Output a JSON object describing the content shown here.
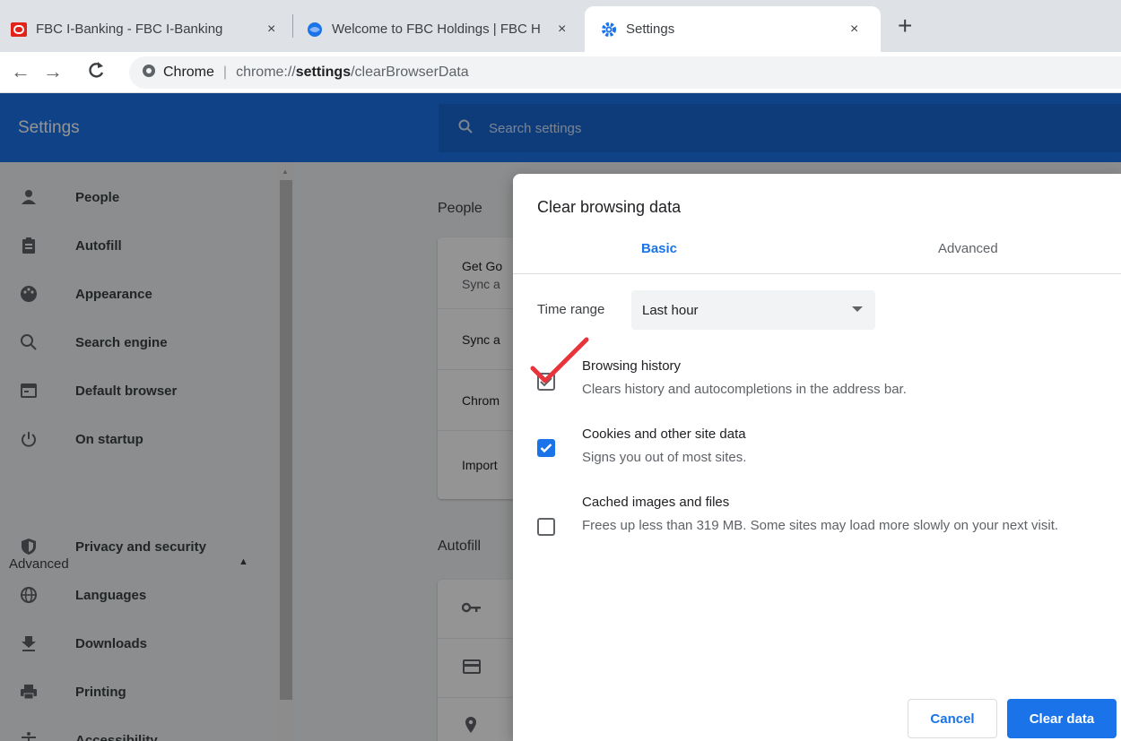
{
  "browser": {
    "tabs": [
      {
        "title": "FBC I-Banking - FBC I-Banking",
        "icon": "oracle-icon"
      },
      {
        "title": "Welcome to FBC Holdings | FBC H",
        "icon": "globe-icon"
      },
      {
        "title": "Settings",
        "icon": "settings-gear-icon"
      }
    ],
    "close_glyph": "×",
    "new_tab_glyph": "+",
    "omnibox": {
      "chip": "Chrome",
      "url_prefix": "chrome://",
      "url_bold": "settings",
      "url_rest": "/clearBrowserData"
    }
  },
  "settings": {
    "title": "Settings",
    "search_placeholder": "Search settings",
    "sidebar": {
      "items": [
        {
          "label": "People",
          "icon": "person-icon"
        },
        {
          "label": "Autofill",
          "icon": "clipboard-icon"
        },
        {
          "label": "Appearance",
          "icon": "palette-icon"
        },
        {
          "label": "Search engine",
          "icon": "search-icon"
        },
        {
          "label": "Default browser",
          "icon": "browser-window-icon"
        },
        {
          "label": "On startup",
          "icon": "power-icon"
        }
      ],
      "advanced_label": "Advanced",
      "advanced_items": [
        {
          "label": "Privacy and security",
          "icon": "shield-icon"
        },
        {
          "label": "Languages",
          "icon": "globe-icon"
        },
        {
          "label": "Downloads",
          "icon": "download-icon"
        },
        {
          "label": "Printing",
          "icon": "printer-icon"
        },
        {
          "label": "Accessibility",
          "icon": "accessibility-icon"
        }
      ]
    },
    "main": {
      "people_title": "People",
      "people_rows": [
        "Get Go",
        "Sync a",
        "Sync a",
        "Chrom",
        "Import"
      ],
      "autofill_title": "Autofill"
    }
  },
  "dialog": {
    "title": "Clear browsing data",
    "tabs": {
      "basic": "Basic",
      "advanced": "Advanced"
    },
    "time_range_label": "Time range",
    "time_range_value": "Last hour",
    "options": [
      {
        "title": "Browsing history",
        "desc": "Clears history and autocompletions in the address bar.",
        "checked": true
      },
      {
        "title": "Cookies and other site data",
        "desc": "Signs you out of most sites.",
        "checked": true
      },
      {
        "title": "Cached images and files",
        "desc": "Frees up less than 319 MB. Some sites may load more slowly on your next visit.",
        "checked": false
      }
    ],
    "cancel_label": "Cancel",
    "clear_label": "Clear data"
  },
  "colors": {
    "accent": "#1a73e8",
    "header_bg": "#1a73e8",
    "annotation": "#e8333a"
  }
}
